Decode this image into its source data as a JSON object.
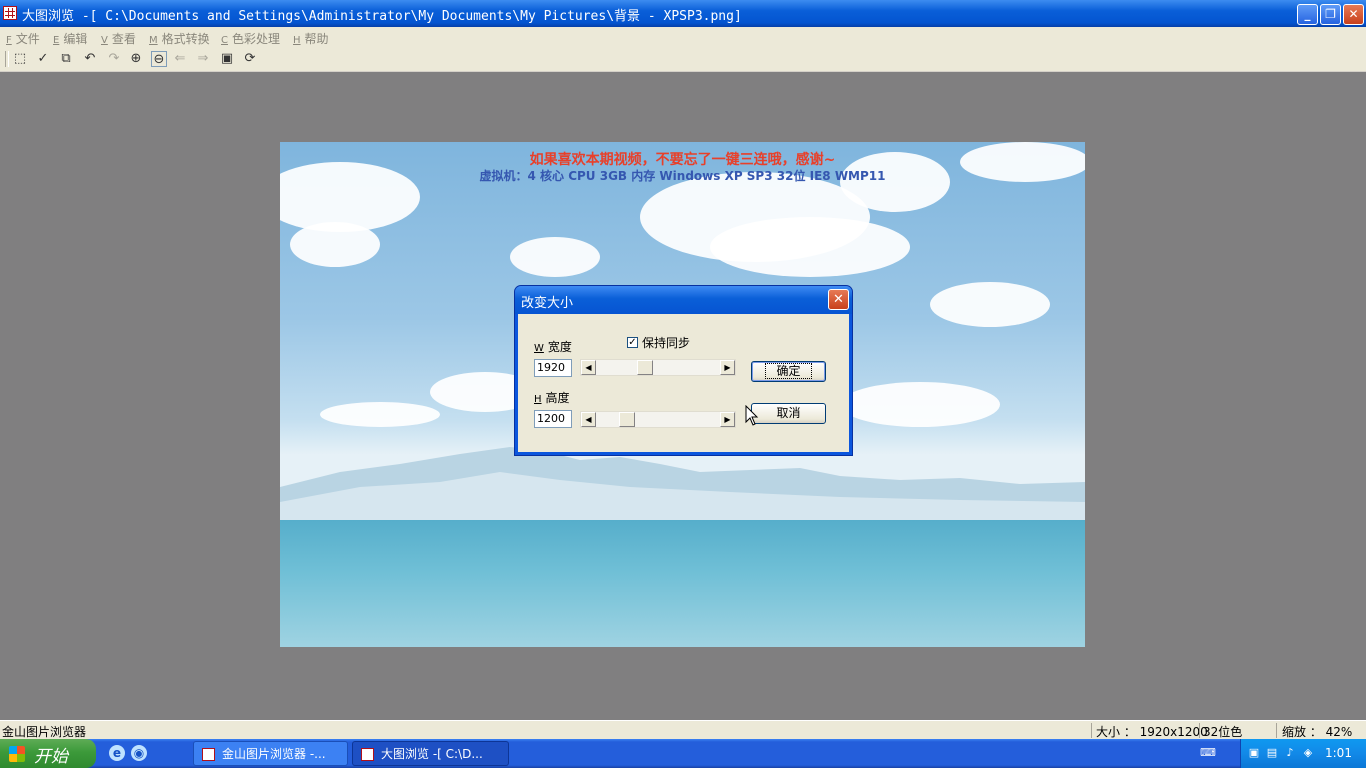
{
  "window": {
    "title": "大图浏览 -[ C:\\Documents and Settings\\Administrator\\My Documents\\My Pictures\\背景 - XPSP3.png]",
    "minimize": "_",
    "maximize": "❐",
    "close": "✕"
  },
  "menu": [
    {
      "key": "F",
      "label": "文件"
    },
    {
      "key": "E",
      "label": "编辑"
    },
    {
      "key": "V",
      "label": "查看"
    },
    {
      "key": "M",
      "label": "格式转换"
    },
    {
      "key": "C",
      "label": "色彩处理"
    },
    {
      "key": "H",
      "label": "帮助"
    }
  ],
  "toolbar_icons": [
    {
      "name": "select-icon",
      "glyph": "⬚"
    },
    {
      "name": "crop-icon",
      "glyph": "✓"
    },
    {
      "name": "copy-icon",
      "glyph": "⧉"
    },
    {
      "name": "undo-icon",
      "glyph": "↶"
    },
    {
      "name": "redo-icon",
      "glyph": "↷"
    },
    {
      "name": "zoom-in-icon",
      "glyph": "⊕"
    },
    {
      "name": "zoom-out-icon",
      "glyph": "⊖"
    },
    {
      "name": "prev-icon",
      "glyph": "⇐"
    },
    {
      "name": "next-icon",
      "glyph": "⇒"
    },
    {
      "name": "fit-icon",
      "glyph": "▣"
    },
    {
      "name": "rotate-icon",
      "glyph": "⟳"
    }
  ],
  "image_banner": {
    "line1": "如果喜欢本期视频，不要忘了一键三连哦，感谢~",
    "line2": "虚拟机：4 核心 CPU    3GB 内存    Windows XP SP3 32位    IE8    WMP11"
  },
  "dialog": {
    "title": "改变大小",
    "close": "✕",
    "width_key": "W",
    "width_label": "宽度",
    "width_value": "1920",
    "height_key": "H",
    "height_label": "高度",
    "height_value": "1200",
    "sync_label": "保持同步",
    "sync_checked": "✓",
    "ok_label": "确定",
    "cancel_label": "取消",
    "arrow_left": "◀",
    "arrow_right": "▶"
  },
  "status": {
    "app": "金山图片浏览器",
    "size": "大小 ： 1920x1200",
    "depth": "32位色",
    "zoom": "缩放 ： 42%"
  },
  "taskbar": {
    "start": "开始",
    "ql_ie": "e",
    "ql_media": "◉",
    "tasks": [
      {
        "label": "金山图片浏览器 -..."
      },
      {
        "label": "大图浏览 -[ C:\\D..."
      }
    ],
    "clock": "1:01",
    "keyboard": "⌨"
  }
}
